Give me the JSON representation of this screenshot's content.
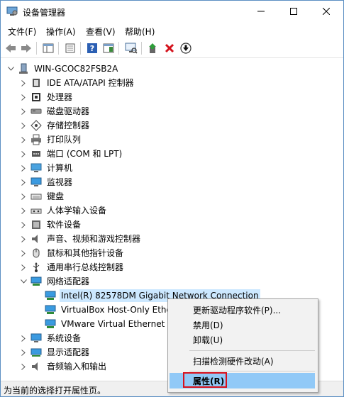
{
  "window": {
    "title": "设备管理器"
  },
  "menu": [
    "文件(F)",
    "操作(A)",
    "查看(V)",
    "帮助(H)"
  ],
  "tree": {
    "root": "WIN-GCOC82FSB2A",
    "categories": [
      "IDE ATA/ATAPI 控制器",
      "处理器",
      "磁盘驱动器",
      "存储控制器",
      "打印队列",
      "端口 (COM 和 LPT)",
      "计算机",
      "监视器",
      "键盘",
      "人体学输入设备",
      "软件设备",
      "声音、视频和游戏控制器",
      "鼠标和其他指针设备",
      "通用串行总线控制器",
      "网络适配器"
    ],
    "network_children": [
      "Intel(R) 82578DM Gigabit Network Connection",
      "VirtualBox Host-Only Ethe",
      "VMware Virtual Ethernet A"
    ],
    "after": [
      "系统设备",
      "显示适配器",
      "音频输入和输出"
    ]
  },
  "context_menu": {
    "items": [
      "更新驱动程序软件(P)...",
      "禁用(D)",
      "卸载(U)",
      "扫描检测硬件改动(A)",
      "属性(R)"
    ]
  },
  "status": "为当前的选择打开属性页。"
}
